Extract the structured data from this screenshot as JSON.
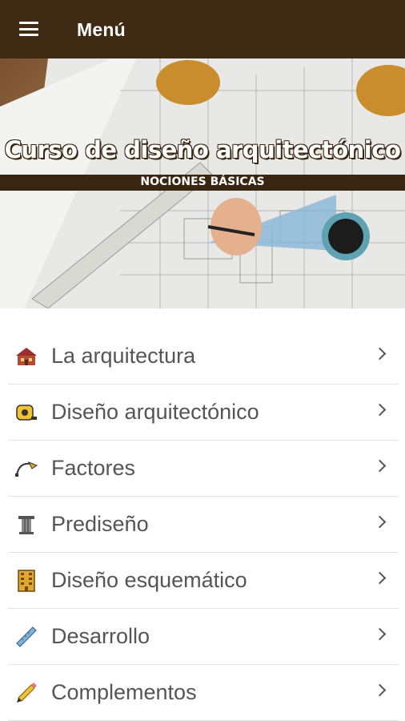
{
  "appbar": {
    "title": "Menú"
  },
  "banner": {
    "title": "Curso de diseño arquitectónico",
    "subtitle": "NOCIONES BÁSICAS"
  },
  "menu": {
    "items": [
      {
        "label": "La arquitectura",
        "icon": "house-icon"
      },
      {
        "label": "Diseño arquitectónico",
        "icon": "tape-measure-icon"
      },
      {
        "label": "Factores",
        "icon": "bezier-curve-icon"
      },
      {
        "label": "Prediseño",
        "icon": "column-icon"
      },
      {
        "label": "Diseño esquemático",
        "icon": "building-icon"
      },
      {
        "label": "Desarrollo",
        "icon": "ruler-icon"
      },
      {
        "label": "Complementos",
        "icon": "pencil-icon"
      }
    ]
  },
  "colors": {
    "appbar_bg": "#3f2a14",
    "banner_strip": "#3a2510",
    "text": "#555555",
    "divider": "#e3e3e3"
  }
}
